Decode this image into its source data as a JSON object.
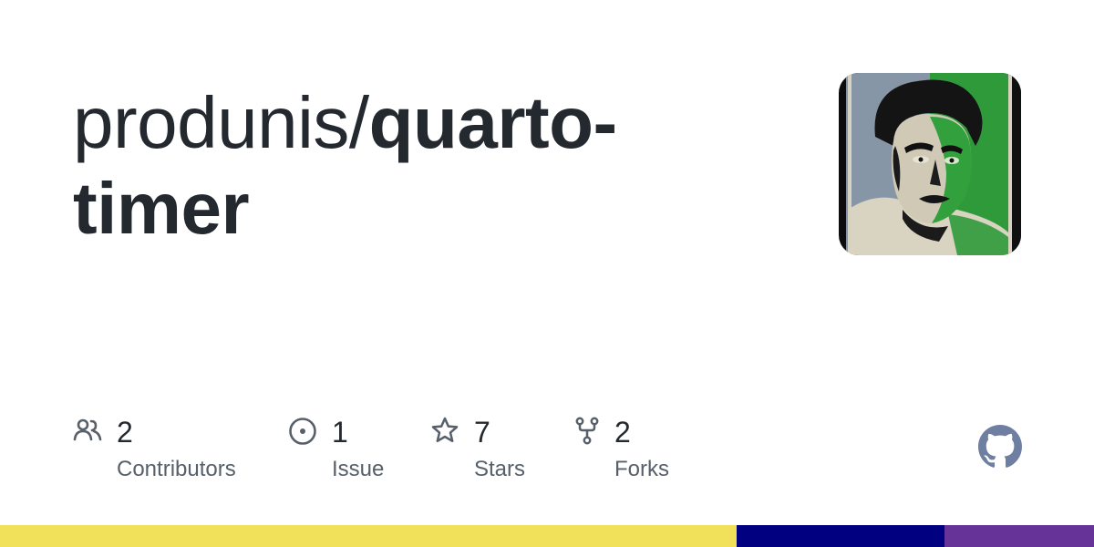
{
  "repo": {
    "owner": "produnis/",
    "name": "quarto-timer"
  },
  "stats": {
    "contributors": {
      "count": "2",
      "label": "Contributors",
      "icon": "people-icon"
    },
    "issues": {
      "count": "1",
      "label": "Issue",
      "icon": "issue-opened-icon"
    },
    "stars": {
      "count": "7",
      "label": "Stars",
      "icon": "star-icon"
    },
    "forks": {
      "count": "2",
      "label": "Forks",
      "icon": "repo-forked-icon"
    }
  },
  "logo": {
    "icon": "github-mark-icon"
  },
  "avatar": {
    "description_icon": "owner-avatar"
  },
  "colors": {
    "icon_gray": "#57606a",
    "logo_gray": "#6e7fa1",
    "language_bar": [
      "#f1e05a",
      "#000080",
      "#663399"
    ]
  },
  "language_bar_shares": [
    0.673,
    0.19,
    0.137
  ]
}
